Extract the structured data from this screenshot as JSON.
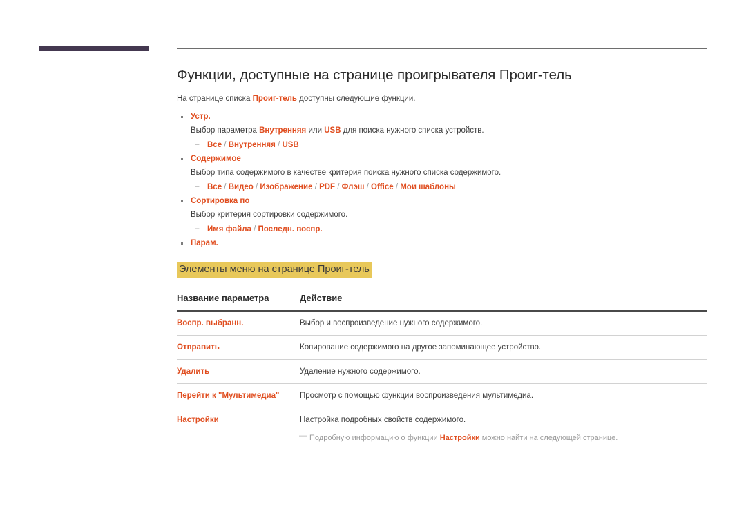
{
  "document": {
    "title": "Функции, доступные на странице проигрывателя Проиг-тель",
    "intro_prefix": "На странице списка ",
    "intro_keyword": "Проиг-тель",
    "intro_suffix": " доступны следующие функции."
  },
  "features": [
    {
      "name": "Устр.",
      "description_prefix": "Выбор параметра ",
      "description_kw1": "Внутренняя",
      "description_mid": " или ",
      "description_kw2": "USB",
      "description_suffix": " для поиска нужного списка устройств.",
      "options": [
        "Все",
        "Внутренняя",
        "USB"
      ]
    },
    {
      "name": "Содержимое",
      "description": "Выбор типа содержимого в качестве критерия поиска нужного списка содержимого.",
      "options": [
        "Все",
        "Видео",
        "Изображение",
        "PDF",
        "Флэш",
        "Office",
        "Мои шаблоны"
      ]
    },
    {
      "name": "Сортировка по",
      "description": "Выбор критерия сортировки содержимого.",
      "options": [
        "Имя файла",
        "Последн. воспр."
      ]
    },
    {
      "name": "Парам.",
      "description": "",
      "options": []
    }
  ],
  "section": {
    "highlight_heading": "Элементы меню на странице Проиг-тель"
  },
  "table": {
    "headers": [
      "Название параметра",
      "Действие"
    ],
    "rows": [
      {
        "parameter": "Воспр. выбранн.",
        "action": "Выбор и воспроизведение нужного содержимого."
      },
      {
        "parameter": "Отправить",
        "action": "Копирование содержимого на другое запоминающее устройство."
      },
      {
        "parameter": "Удалить",
        "action": "Удаление нужного содержимого."
      },
      {
        "parameter": "Перейти к \"Мультимедиа\"",
        "action": "Просмотр с помощью функции воспроизведения мультимедиа."
      },
      {
        "parameter": "Настройки",
        "action": "Настройка подробных свойств содержимого.",
        "note_prefix": "Подробную информацию о функции ",
        "note_keyword": "Настройки",
        "note_suffix": " можно найти на следующей странице."
      }
    ]
  },
  "colors": {
    "accent_orange": "#e04e20",
    "highlight_yellow": "#e8c85a",
    "corner_bar": "#443850",
    "body_text": "#3f3f3f",
    "note_gray": "#9b9b9b"
  }
}
